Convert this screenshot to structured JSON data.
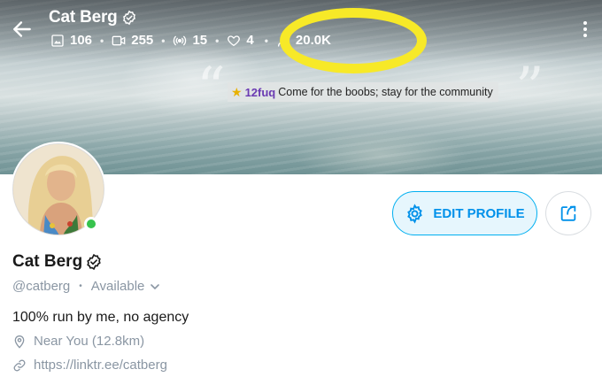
{
  "header": {
    "title": "Cat Berg",
    "stats": {
      "photos": "106",
      "videos": "255",
      "streams": "15",
      "likes": "4",
      "fans": "20.0K"
    }
  },
  "banner": {
    "username": "12fuq",
    "message": "Come for the boobs; stay for the community"
  },
  "actions": {
    "edit_profile_label": "EDIT PROFILE"
  },
  "profile": {
    "name": "Cat Berg",
    "handle": "@catberg",
    "availability": "Available",
    "bio": "100% run by me, no agency",
    "location": "Near You (12.8km)",
    "link": "https://linktr.ee/catberg",
    "online": true
  },
  "colors": {
    "accent": "#00aff0",
    "accent_text": "#0091ea",
    "online": "#37c34d",
    "highlight": "#f7e928",
    "muted": "#8a96a3"
  },
  "icons": [
    "back-arrow-icon",
    "verified-icon",
    "image-icon",
    "video-icon",
    "stream-icon",
    "heart-icon",
    "fans-icon",
    "more-vertical-icon",
    "gear-icon",
    "share-icon",
    "chevron-down-icon",
    "location-pin-icon",
    "link-icon"
  ]
}
